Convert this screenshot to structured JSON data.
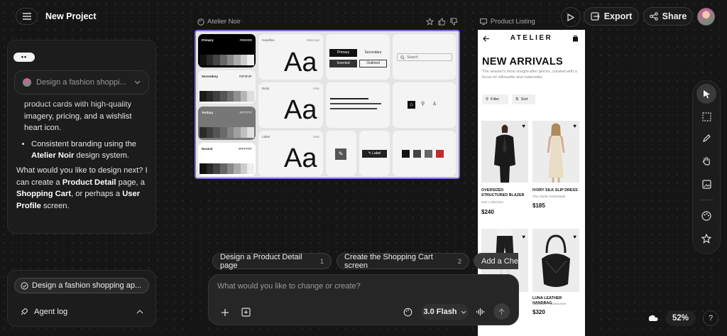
{
  "header": {
    "title": "New Project",
    "export_label": "Export",
    "share_label": "Share"
  },
  "left": {
    "mode_indicator": "••",
    "prompt_select": "Design a fashion shoppi...",
    "chat": {
      "line_cut": "product cards with high-quality",
      "line_2": "imagery, pricing, and a wishlist",
      "line_3": "heart icon.",
      "bullet_pre": "Consistent branding using the",
      "bullet_bold": "Atelier Noir",
      "bullet_post": "design system.",
      "q_1": "What would you like to design next? I can create a",
      "q_pd": "Product Detail",
      "q_2": "page, a",
      "q_sc": "Shopping Cart",
      "q_3": ", or perhaps a",
      "q_up": "User Profile",
      "q_4": "screen."
    },
    "active_task": "Design a fashion shopping ap...",
    "agent_log": "Agent log"
  },
  "suggestions": [
    {
      "label": "Design a Product Detail page",
      "num": "1"
    },
    {
      "label": "Create the Shopping Cart screen",
      "num": "2"
    },
    {
      "label": "Add a Chec",
      "num": ""
    }
  ],
  "composer": {
    "placeholder": "What would you like to change or create?",
    "model": "3.0 Flash"
  },
  "design_system": {
    "frame_label": "Atelier Noir",
    "colors": [
      {
        "name": "Primary",
        "hex": "#000000"
      },
      {
        "name": "Secondary",
        "hex": "#3F3F3F"
      },
      {
        "name": "Tertiary",
        "hex": "#777777"
      },
      {
        "name": "Neutral",
        "hex": "#FFFFFF"
      }
    ],
    "type": [
      {
        "role": "Headline",
        "font": "Manrope",
        "sample": "Aa"
      },
      {
        "role": "Body",
        "font": "Inter",
        "sample": "Aa"
      },
      {
        "role": "Label",
        "font": "Inter",
        "sample": "Aa"
      }
    ],
    "buttons": {
      "primary": "Primary",
      "secondary": "Secondary",
      "inverted": "Inverted",
      "outlined": "Outlined"
    },
    "search_placeholder": "Search",
    "label_chip": "Label"
  },
  "listing": {
    "frame_label": "Product Listing",
    "brand": "ATELIER",
    "heading": "NEW ARRIVALS",
    "subtitle": "The season's most sought-after pieces, curated with a focus on silhouette and materiality.",
    "filter": "Filter",
    "sort": "Sort",
    "products": [
      {
        "name": "OVERSIZED STRUCTURED BLAZER",
        "collection": "Noir Collection",
        "price": "$240"
      },
      {
        "name": "IVORY SILK SLIP DRESS",
        "collection": "The Atelier Essentials",
        "price": "$185"
      },
      {
        "name": "",
        "collection": "",
        "price": ""
      },
      {
        "name": "LUNA LEATHER HANDBAG",
        "collection": "Signature Accessories",
        "price": "$320"
      }
    ]
  },
  "zoom": "52%",
  "help": "?",
  "colors": {
    "bg": "#151515",
    "panel": "#1c1c1c",
    "selection": "#7b6fe0"
  }
}
